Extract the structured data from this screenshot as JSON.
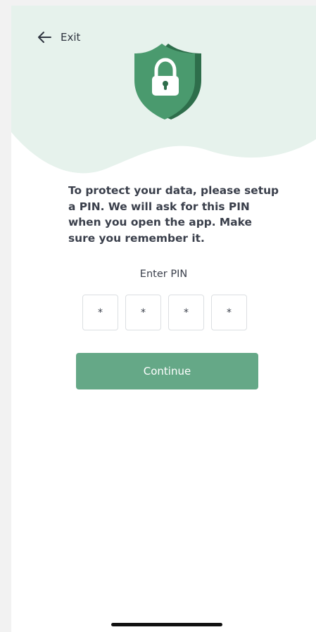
{
  "header": {
    "back_label": "Exit",
    "back_icon": "arrow-left-icon"
  },
  "hero": {
    "icon": "shield-lock-icon"
  },
  "message": {
    "text": "To protect your data, please setup a PIN. We will ask for this PIN when you open the app. Make sure you remember it."
  },
  "pin": {
    "label": "Enter PIN",
    "digits": [
      "*",
      "*",
      "*",
      "*"
    ]
  },
  "actions": {
    "continue_label": "Continue"
  },
  "colors": {
    "accent": "#65a887",
    "blob": "#e6f2ec",
    "shield_front": "#4a9a6e",
    "shield_back": "#2e6e4b",
    "text": "#3a3f4b"
  }
}
